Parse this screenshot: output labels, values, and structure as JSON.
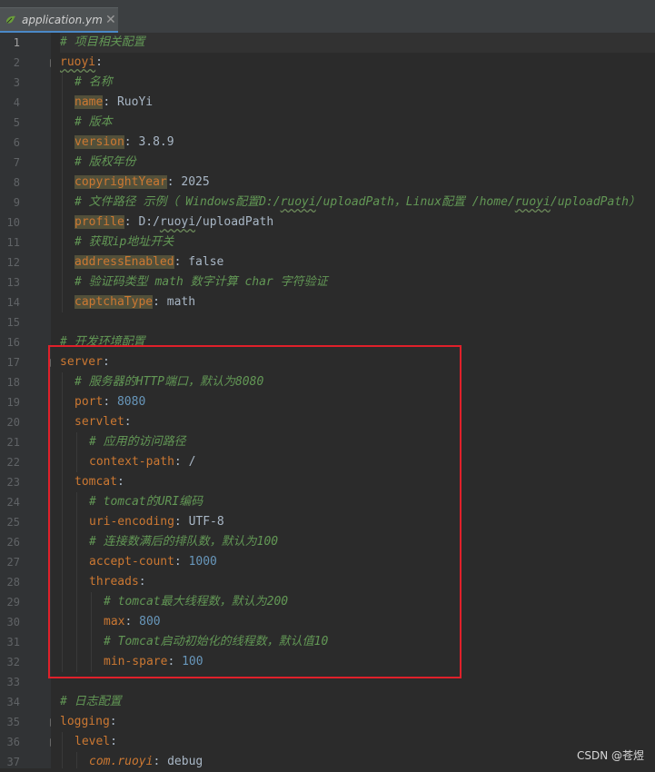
{
  "tab": {
    "filename": "application.yml"
  },
  "lines": [
    {
      "num": "1",
      "indent": 0,
      "segs": [
        [
          "cm",
          "# 项目相关配置"
        ]
      ]
    },
    {
      "num": "2",
      "indent": 0,
      "segs": [
        [
          "kw",
          "ruoyi"
        ],
        [
          "p",
          ":"
        ]
      ]
    },
    {
      "num": "3",
      "indent": 1,
      "segs": [
        [
          "cm",
          "# 名称"
        ]
      ]
    },
    {
      "num": "4",
      "indent": 1,
      "segs": [
        [
          "kb",
          "name"
        ],
        [
          "p",
          ": "
        ],
        [
          "v",
          "RuoYi"
        ]
      ]
    },
    {
      "num": "5",
      "indent": 1,
      "segs": [
        [
          "cm",
          "# 版本"
        ]
      ]
    },
    {
      "num": "6",
      "indent": 1,
      "segs": [
        [
          "kb",
          "version"
        ],
        [
          "p",
          ": "
        ],
        [
          "v",
          "3.8.9"
        ]
      ]
    },
    {
      "num": "7",
      "indent": 1,
      "segs": [
        [
          "cm",
          "# 版权年份"
        ]
      ]
    },
    {
      "num": "8",
      "indent": 1,
      "segs": [
        [
          "kb",
          "copyrightYear"
        ],
        [
          "p",
          ": "
        ],
        [
          "v",
          "2025"
        ]
      ]
    },
    {
      "num": "9",
      "indent": 1,
      "segs": [
        [
          "cm",
          "# 文件路径 示例（ Windows配置D:/"
        ],
        [
          "cmw",
          "ruoyi"
        ],
        [
          "cm",
          "/uploadPath，Linux配置 /home/"
        ],
        [
          "cmw",
          "ruoyi"
        ],
        [
          "cm",
          "/uploadPath）"
        ]
      ]
    },
    {
      "num": "10",
      "indent": 1,
      "segs": [
        [
          "kb",
          "profile"
        ],
        [
          "p",
          ": "
        ],
        [
          "v",
          "D:/"
        ],
        [
          "vw",
          "ruoyi"
        ],
        [
          "v",
          "/uploadPath"
        ]
      ]
    },
    {
      "num": "11",
      "indent": 1,
      "segs": [
        [
          "cm",
          "# 获取ip地址开关"
        ]
      ]
    },
    {
      "num": "12",
      "indent": 1,
      "segs": [
        [
          "kb",
          "addressEnabled"
        ],
        [
          "p",
          ": "
        ],
        [
          "v",
          "false"
        ]
      ]
    },
    {
      "num": "13",
      "indent": 1,
      "segs": [
        [
          "cm",
          "# 验证码类型 math 数字计算 char 字符验证"
        ]
      ]
    },
    {
      "num": "14",
      "indent": 1,
      "segs": [
        [
          "kb",
          "captchaType"
        ],
        [
          "p",
          ": "
        ],
        [
          "v",
          "math"
        ]
      ]
    },
    {
      "num": "15",
      "indent": 0,
      "segs": []
    },
    {
      "num": "16",
      "indent": 0,
      "segs": [
        [
          "cm",
          "# 开发环境配置"
        ]
      ]
    },
    {
      "num": "17",
      "indent": 0,
      "segs": [
        [
          "k",
          "server"
        ],
        [
          "p",
          ":"
        ]
      ]
    },
    {
      "num": "18",
      "indent": 1,
      "segs": [
        [
          "cm",
          "# 服务器的HTTP端口，默认为8080"
        ]
      ]
    },
    {
      "num": "19",
      "indent": 1,
      "segs": [
        [
          "k",
          "port"
        ],
        [
          "p",
          ": "
        ],
        [
          "n",
          "8080"
        ]
      ]
    },
    {
      "num": "20",
      "indent": 1,
      "segs": [
        [
          "k",
          "servlet"
        ],
        [
          "p",
          ":"
        ]
      ]
    },
    {
      "num": "21",
      "indent": 2,
      "segs": [
        [
          "cm",
          "# 应用的访问路径"
        ]
      ]
    },
    {
      "num": "22",
      "indent": 2,
      "segs": [
        [
          "k",
          "context-path"
        ],
        [
          "p",
          ": "
        ],
        [
          "v",
          "/"
        ]
      ]
    },
    {
      "num": "23",
      "indent": 1,
      "segs": [
        [
          "k",
          "tomcat"
        ],
        [
          "p",
          ":"
        ]
      ]
    },
    {
      "num": "24",
      "indent": 2,
      "segs": [
        [
          "cm",
          "# tomcat的URI编码"
        ]
      ]
    },
    {
      "num": "25",
      "indent": 2,
      "segs": [
        [
          "k",
          "uri-encoding"
        ],
        [
          "p",
          ": "
        ],
        [
          "v",
          "UTF-8"
        ]
      ]
    },
    {
      "num": "26",
      "indent": 2,
      "segs": [
        [
          "cm",
          "# 连接数满后的排队数，默认为100"
        ]
      ]
    },
    {
      "num": "27",
      "indent": 2,
      "segs": [
        [
          "k",
          "accept-count"
        ],
        [
          "p",
          ": "
        ],
        [
          "n",
          "1000"
        ]
      ]
    },
    {
      "num": "28",
      "indent": 2,
      "segs": [
        [
          "k",
          "threads"
        ],
        [
          "p",
          ":"
        ]
      ]
    },
    {
      "num": "29",
      "indent": 3,
      "segs": [
        [
          "cm",
          "# tomcat最大线程数，默认为200"
        ]
      ]
    },
    {
      "num": "30",
      "indent": 3,
      "segs": [
        [
          "k",
          "max"
        ],
        [
          "p",
          ": "
        ],
        [
          "n",
          "800"
        ]
      ]
    },
    {
      "num": "31",
      "indent": 3,
      "segs": [
        [
          "cm",
          "# Tomcat启动初始化的线程数，默认值10"
        ]
      ]
    },
    {
      "num": "32",
      "indent": 3,
      "segs": [
        [
          "k",
          "min-spare"
        ],
        [
          "p",
          ": "
        ],
        [
          "n",
          "100"
        ]
      ]
    },
    {
      "num": "33",
      "indent": 0,
      "segs": []
    },
    {
      "num": "34",
      "indent": 0,
      "segs": [
        [
          "cm",
          "# 日志配置"
        ]
      ]
    },
    {
      "num": "35",
      "indent": 0,
      "segs": [
        [
          "k",
          "logging"
        ],
        [
          "p",
          ":"
        ]
      ]
    },
    {
      "num": "36",
      "indent": 1,
      "segs": [
        [
          "k",
          "level"
        ],
        [
          "p",
          ":"
        ]
      ]
    },
    {
      "num": "37",
      "indent": 2,
      "segs": [
        [
          "ki",
          "com."
        ],
        [
          "kiw",
          "ruoyi"
        ],
        [
          "p",
          ": "
        ],
        [
          "v",
          "debug"
        ]
      ]
    }
  ],
  "watermark": "CSDN @苍煜",
  "colors": {
    "highlight_box": "#e0202a",
    "comment": "#629755",
    "key": "#cc7832",
    "number": "#6897bb"
  }
}
